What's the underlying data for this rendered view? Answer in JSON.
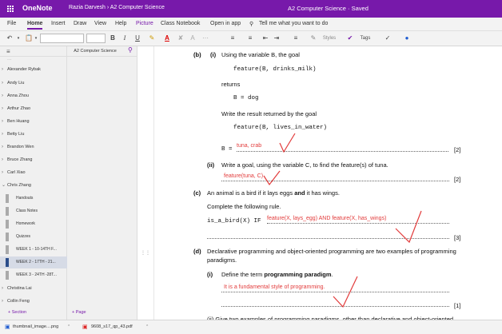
{
  "titlebar": {
    "app_name": "OneNote",
    "breadcrumb": "Razia Darvesh  ›  A2 Computer Science",
    "doc_title": "A2 Computer Science  ·  Saved"
  },
  "ribbon": {
    "tabs": [
      "File",
      "Home",
      "Insert",
      "Draw",
      "View",
      "Help",
      "Picture",
      "Class Notebook",
      "Open in app"
    ],
    "tell_me": "Tell me what you want to do"
  },
  "toolbar": {
    "bold": "B",
    "italic": "I",
    "underline": "U",
    "styles": "Styles",
    "tags": "Tags"
  },
  "sections_header": {
    "notebook": "A2 Computer Science"
  },
  "sections": [
    {
      "label": "Alexander Rybak",
      "chev": "›"
    },
    {
      "label": "Andy Liu",
      "chev": "›"
    },
    {
      "label": "Anna Zhou",
      "chev": "›"
    },
    {
      "label": "Arthur Zhao",
      "chev": "›"
    },
    {
      "label": "Ben Huang",
      "chev": "›"
    },
    {
      "label": "Betty Liu",
      "chev": "›"
    },
    {
      "label": "Brandon Wen",
      "chev": "›"
    },
    {
      "label": "Bruce Zhang",
      "chev": "›"
    },
    {
      "label": "Carl Xiao",
      "chev": "›"
    },
    {
      "label": "Chris Zhang",
      "chev": "⌄"
    }
  ],
  "subsections": [
    "Handouts",
    "Class Notes",
    "Homework",
    "Quizzes",
    "WEEK 1 - 10-14TH F...",
    "WEEK 2 - 17TH - 21...",
    "WEEK 3 - 24TH -28T..."
  ],
  "sections_after": [
    {
      "label": "Christina Lai",
      "chev": "›"
    },
    {
      "label": "Collin Feng",
      "chev": "›"
    }
  ],
  "add": {
    "section": "+ Section",
    "page": "+ Page"
  },
  "content": {
    "b_label": "(b)",
    "i_label": "(i)",
    "b_i_text": "Using the variable B, the goal",
    "goal1": "feature(B, drinks_milk)",
    "returns": "returns",
    "b_dog": "B = dog",
    "write_result": "Write the result returned by the goal",
    "goal2": "feature(B, lives_in_water)",
    "b_eq": "B = ",
    "ans1": "tuna, crab",
    "mark2a": "[2]",
    "ii_label": "(ii)",
    "ii_text": "Write a goal, using the variable C, to find the feature(s) of tuna.",
    "ans2": "feature(tuna, C)",
    "mark2b": "[2]",
    "c_label": "(c)",
    "c_text_1": "An animal is a bird if it lays eggs ",
    "c_and": "and",
    "c_text_2": " it has wings.",
    "complete_rule": "Complete the following rule.",
    "rule_start": "is_a_bird(X) IF ",
    "ans3": "feature(X, lays_egg) AND feature(X, has_wings)",
    "mark3": "[3]",
    "d_label": "(d)",
    "d_text_1": "Declarative programming and object-oriented programming are two examples of programming",
    "d_text_2": "paradigms.",
    "di_label": "(i)",
    "di_text_1": "Define the term ",
    "di_bold": "programming paradigm",
    "di_text_2": ".",
    "ans4": "It is a fundamental style of programming.",
    "mark1": "[1]",
    "dii_partial": "(ii)   Give two examples of programming paradigms, other than declarative and object-oriented"
  },
  "taskbar": {
    "file1": "thumbnail_image....png",
    "file2": "9608_s17_qp_43.pdf"
  },
  "colors": {
    "brand": "#7719aa",
    "annotation": "#e23b3b",
    "selected": "#d6dbe6"
  }
}
